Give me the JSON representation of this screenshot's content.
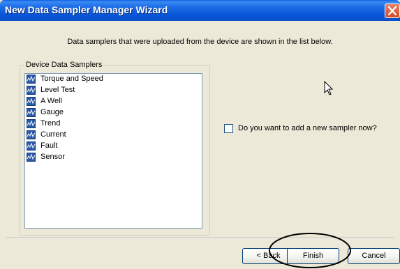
{
  "window": {
    "title": "New Data Sampler Manager Wizard"
  },
  "description": "Data samplers that were uploaded from the device are shown in the list below.",
  "group": {
    "label": "Device Data Samplers",
    "items": [
      {
        "label": "Torque and Speed",
        "icon": "data-sampler-icon"
      },
      {
        "label": "Level Test",
        "icon": "data-sampler-icon"
      },
      {
        "label": "A Well",
        "icon": "data-sampler-icon"
      },
      {
        "label": "Gauge",
        "icon": "data-sampler-icon"
      },
      {
        "label": "Trend",
        "icon": "data-sampler-icon"
      },
      {
        "label": "Current",
        "icon": "data-sampler-icon"
      },
      {
        "label": "Fault",
        "icon": "data-sampler-icon"
      },
      {
        "label": "Sensor",
        "icon": "data-sampler-icon"
      }
    ]
  },
  "checkbox": {
    "label": "Do you want to add a new sampler now?",
    "checked": false
  },
  "buttons": {
    "back": "< Back",
    "finish": "Finish",
    "cancel": "Cancel"
  },
  "colors": {
    "titlebar": "#0a5fde",
    "dialog": "#ece9d8",
    "close": "#d44a22",
    "icon": "#2a5aa8"
  }
}
